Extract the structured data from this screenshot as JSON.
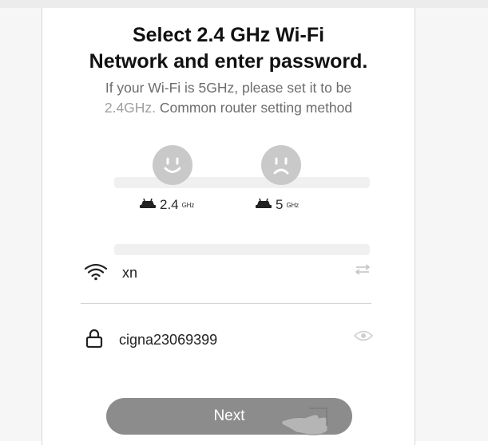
{
  "header": {
    "title_line1": "Select 2.4 GHz Wi-Fi",
    "title_line2": "Network and enter password.",
    "subtitle_line1": "If your Wi-Fi is 5GHz, please set it to be",
    "subtitle_line2_prefix": "2.4GHz. ",
    "subtitle_line2_link": "Common router setting method"
  },
  "frequency_options": [
    {
      "face": "smiling-face-icon",
      "number": "2.4",
      "unit": "GHz",
      "router_icon": "router-icon"
    },
    {
      "face": "frowning-face-icon",
      "number": "5",
      "unit": "GHz",
      "router_icon": "router-icon"
    }
  ],
  "wifi_field": {
    "icon": "wifi-icon",
    "value": "xn",
    "action_icon": "swap-icon"
  },
  "password_field": {
    "icon": "lock-icon",
    "value": "cigna23069399",
    "action_icon": "eye-icon"
  },
  "next_button": {
    "label": "Next"
  },
  "colors": {
    "title": "#111111",
    "subtitle": "#6d6d6d",
    "face_bg": "#c9c9c9",
    "button_bg": "#8c8c8c",
    "button_text": "#ffffff"
  }
}
